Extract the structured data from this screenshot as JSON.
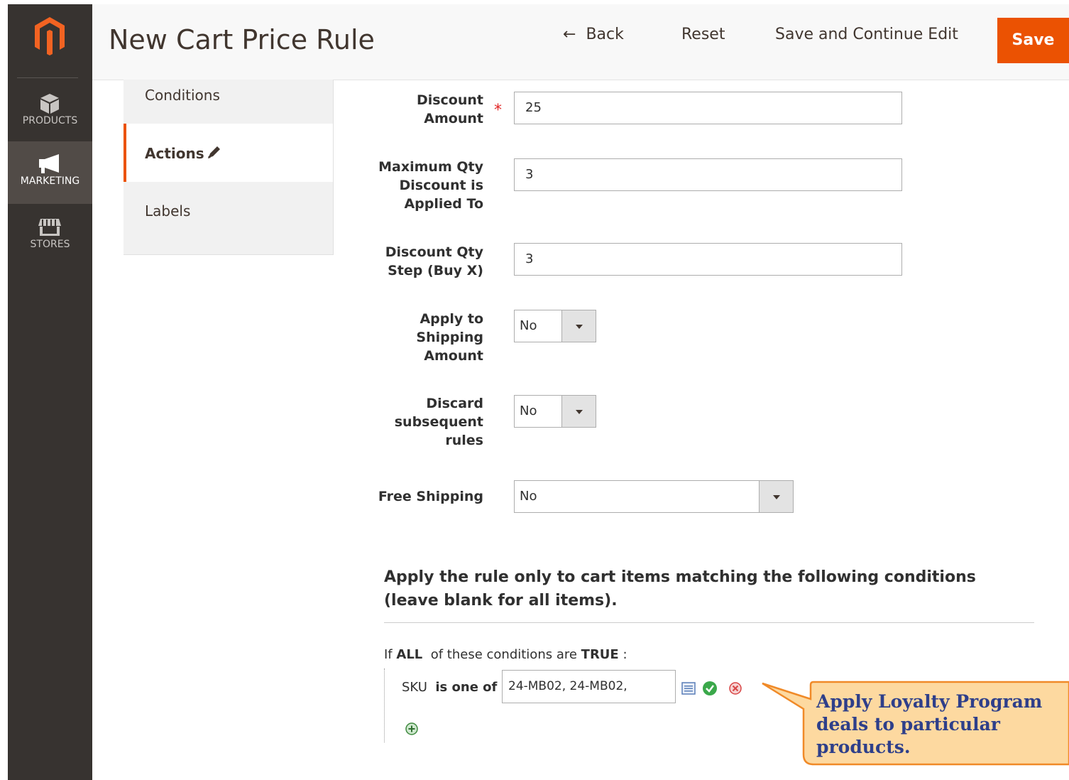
{
  "sidebar": {
    "items": [
      {
        "label": "PRODUCTS",
        "icon": "box-icon"
      },
      {
        "label": "MARKETING",
        "icon": "megaphone-icon"
      },
      {
        "label": "STORES",
        "icon": "store-icon"
      }
    ],
    "active": "MARKETING"
  },
  "header": {
    "title": "New Cart Price Rule",
    "back_label": "Back",
    "reset_label": "Reset",
    "save_continue_label": "Save and Continue Edit",
    "save_label": "Save"
  },
  "tabs": {
    "conditions": "Conditions",
    "actions": "Actions",
    "labels": "Labels",
    "active": "Actions"
  },
  "form": {
    "discount_amount": {
      "label_line1": "Discount",
      "label_line2": "Amount",
      "value": "25",
      "required": true
    },
    "max_qty": {
      "label_line1": "Maximum Qty",
      "label_line2": "Discount is",
      "label_line3": "Applied To",
      "value": "3"
    },
    "qty_step": {
      "label_line1": "Discount Qty",
      "label_line2": "Step (Buy X)",
      "value": "3"
    },
    "apply_shipping": {
      "label_line1": "Apply to",
      "label_line2": "Shipping",
      "label_line3": "Amount",
      "value": "No"
    },
    "discard_rules": {
      "label_line1": "Discard",
      "label_line2": "subsequent",
      "label_line3": "rules",
      "value": "No"
    },
    "free_shipping": {
      "label": "Free Shipping",
      "value": "No"
    }
  },
  "conditions": {
    "heading": "Apply the rule only to cart items matching the following conditions (leave blank for all items).",
    "intro_if": "If",
    "intro_all": "ALL",
    "intro_mid": "of these conditions are",
    "intro_true": "TRUE",
    "intro_end": ":",
    "sku_attr": "SKU",
    "sku_op": "is one of",
    "sku_value": "24-MB02, 24-MB02,"
  },
  "callout": {
    "text": "Apply Loyalty Program deals to particular products.",
    "fill": "#fdd9a0",
    "stroke": "#f08a28"
  },
  "colors": {
    "accent": "#eb5202",
    "sidebar_bg": "#373330",
    "sidebar_active": "#514b47"
  }
}
